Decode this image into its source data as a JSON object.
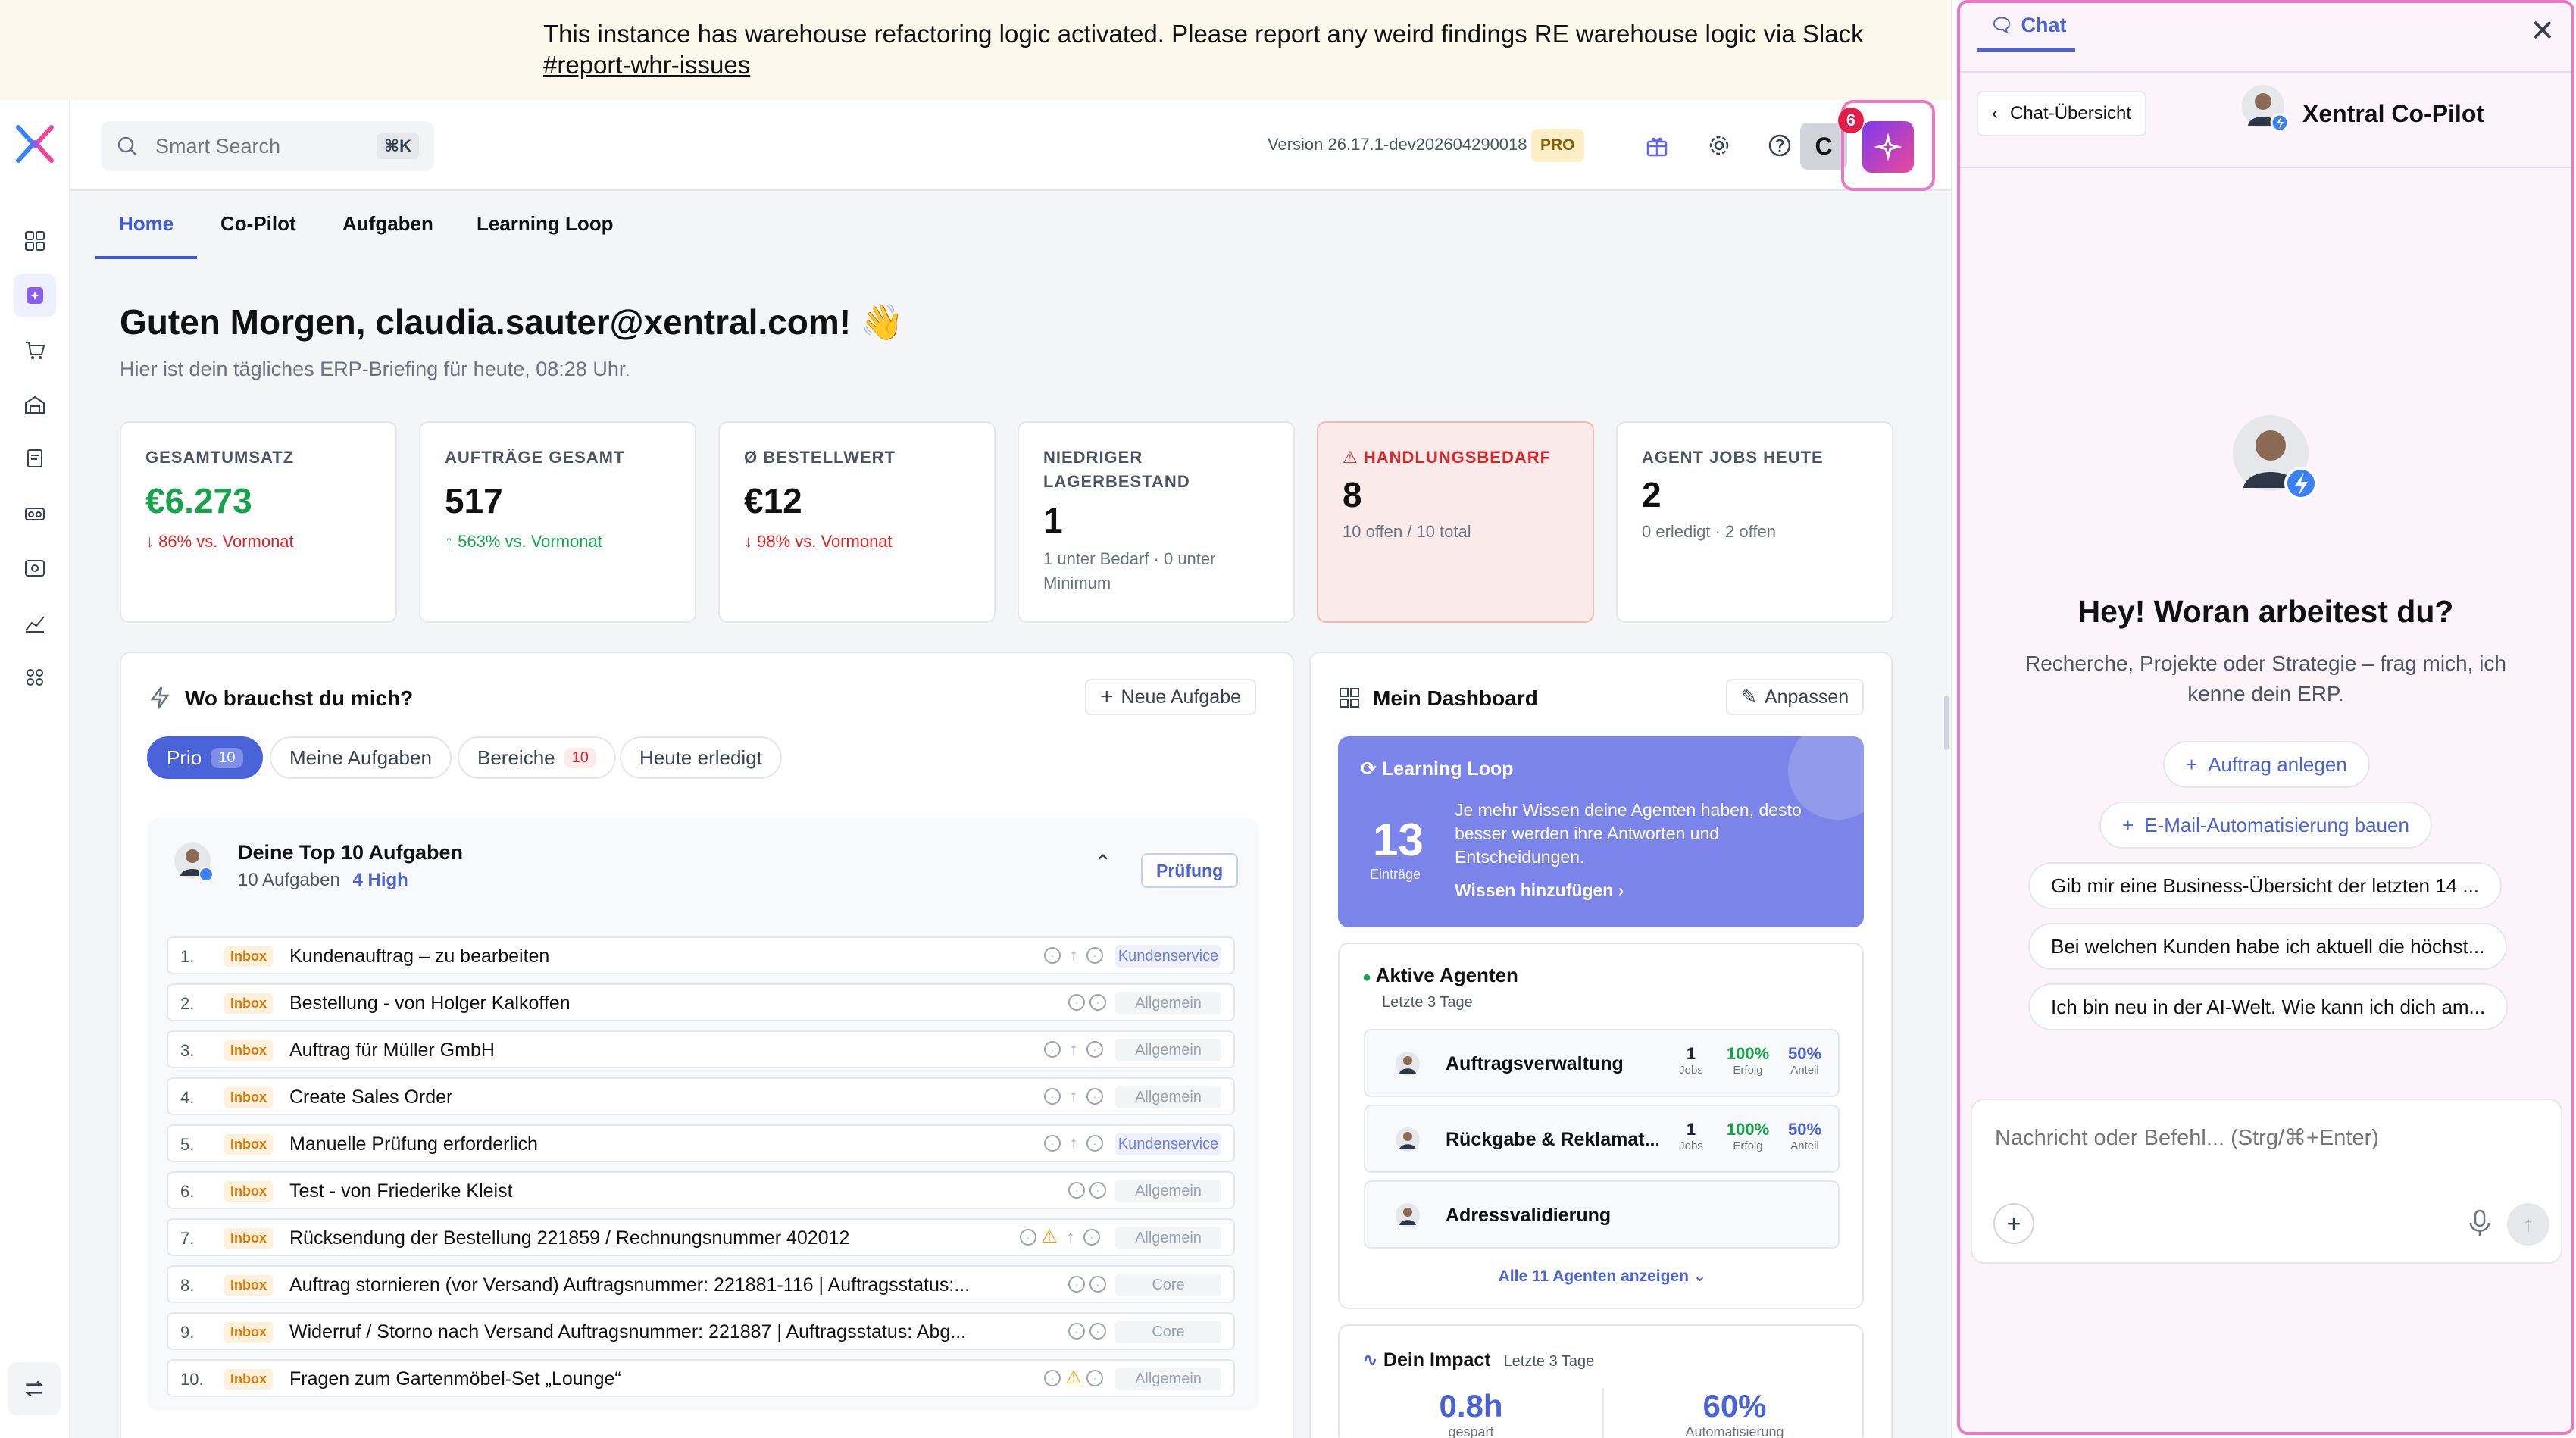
{
  "banner": {
    "text": "This instance has warehouse refactoring logic activated. Please report any weird findings RE warehouse logic via Slack ",
    "link": "#report-whr-issues"
  },
  "topbar": {
    "search_placeholder": "Smart Search",
    "search_shortcut": "⌘K",
    "version": "Version 26.17.1-dev202604290018",
    "plan_badge": "PRO",
    "user_initial": "C",
    "notification_count": "6"
  },
  "tabs": [
    "Home",
    "Co-Pilot",
    "Aufgaben",
    "Learning Loop"
  ],
  "greeting": {
    "title": "Guten Morgen, claudia.sauter@xentral.com! 👋",
    "subtitle": "Hier ist dein tägliches ERP-Briefing für heute, 08:28 Uhr."
  },
  "kpis": [
    {
      "label": "GESAMTUMSATZ",
      "value": "€6.273",
      "delta": "↓ 86% vs. Vormonat"
    },
    {
      "label": "AUFTRÄGE GESAMT",
      "value": "517",
      "delta": "↑ 563% vs. Vormonat"
    },
    {
      "label": "Ø BESTELLWERT",
      "value": "€12",
      "delta": "↓ 98% vs. Vormonat"
    },
    {
      "label": "NIEDRIGER LAGERBESTAND",
      "value": "1",
      "delta": "1 unter Bedarf · 0 unter Minimum"
    },
    {
      "label": "HANDLUNGSBEDARF",
      "value": "8",
      "delta": "10 offen / 10 total"
    },
    {
      "label": "AGENT JOBS HEUTE",
      "value": "2",
      "delta": "0 erledigt · 2 offen"
    }
  ],
  "tasks_panel": {
    "title": "Wo brauchst du mich?",
    "new_task": "Neue Aufgabe",
    "chips": [
      {
        "label": "Prio",
        "count": "10"
      },
      {
        "label": "Meine Aufgaben",
        "count": ""
      },
      {
        "label": "Bereiche",
        "count": "10"
      },
      {
        "label": "Heute erledigt",
        "count": ""
      }
    ],
    "top10_title": "Deine Top 10 Aufgaben",
    "top10_count": "10 Aufgaben",
    "top10_high": "4 High",
    "review_button": "Prüfung",
    "rows": [
      {
        "num": "1.",
        "tag": "Inbox",
        "text": "Kundenauftrag – zu bearbeiten",
        "category": "Kundenservice"
      },
      {
        "num": "2.",
        "tag": "Inbox",
        "text": "Bestellung - von Holger Kalkoffen",
        "category": "Allgemein"
      },
      {
        "num": "3.",
        "tag": "Inbox",
        "text": "Auftrag für Müller GmbH",
        "category": "Allgemein"
      },
      {
        "num": "4.",
        "tag": "Inbox",
        "text": "Create Sales Order",
        "category": "Allgemein"
      },
      {
        "num": "5.",
        "tag": "Inbox",
        "text": "Manuelle Prüfung erforderlich",
        "category": "Kundenservice"
      },
      {
        "num": "6.",
        "tag": "Inbox",
        "text": "Test - von Friederike Kleist",
        "category": "Allgemein"
      },
      {
        "num": "7.",
        "tag": "Inbox",
        "text": "Rücksendung der Bestellung 221859 / Rechnungsnummer 402012",
        "category": "Allgemein"
      },
      {
        "num": "8.",
        "tag": "Inbox",
        "text": "Auftrag stornieren (vor Versand) Auftragsnummer: 221881-116 | Auftragsstatus:...",
        "category": "Core"
      },
      {
        "num": "9.",
        "tag": "Inbox",
        "text": "Widerruf / Storno nach Versand Auftragsnummer: 221887 | Auftragsstatus: Abg...",
        "category": "Core"
      },
      {
        "num": "10.",
        "tag": "Inbox",
        "text": "Fragen zum Gartenmöbel-Set „Lounge“",
        "category": "Allgemein"
      }
    ]
  },
  "dashboard": {
    "title": "Mein Dashboard",
    "customize": "Anpassen",
    "learning_loop": {
      "title": "Learning Loop",
      "count": "13",
      "count_label": "Einträge",
      "text": "Je mehr Wissen deine Agenten haben, desto besser werden ihre Antworten und Entscheidungen.",
      "cta": "Wissen hinzufügen ›"
    },
    "agents": {
      "title": "Aktive Agenten",
      "subtitle": "Letzte 3 Tage",
      "list": [
        {
          "name": "Auftragsverwaltung",
          "jobs": "1",
          "jobs_label": "Jobs",
          "success": "100%",
          "success_label": "Erfolg",
          "share": "50%",
          "share_label": "Anteil"
        },
        {
          "name": "Rückgabe & Reklamat...",
          "jobs": "1",
          "jobs_label": "Jobs",
          "success": "100%",
          "success_label": "Erfolg",
          "share": "50%",
          "share_label": "Anteil"
        },
        {
          "name": "Adressvalidierung",
          "jobs": "",
          "jobs_label": "",
          "success": "",
          "success_label": "",
          "share": "",
          "share_label": ""
        }
      ],
      "show_all": "Alle 11 Agenten anzeigen"
    },
    "impact": {
      "title": "Dein Impact",
      "subtitle": "Letzte 3 Tage",
      "metric1_value": "0.8h",
      "metric1_label": "gespart",
      "metric2_value": "60%",
      "metric2_label": "Automatisierung"
    }
  },
  "chat": {
    "tab": "Chat",
    "back": "Chat-Übersicht",
    "title": "Xentral Co-Pilot",
    "heading": "Hey! Woran arbeitest du?",
    "subheading": "Recherche, Projekte oder Strategie – frag mich, ich kenne dein ERP.",
    "suggestions": [
      "Auftrag anlegen",
      "E-Mail-Automatisierung bauen",
      "Gib mir eine Business-Übersicht der letzten 14 ...",
      "Bei welchen Kunden habe ich aktuell die höchst...",
      "Ich bin neu in der AI-Welt. Wie kann ich dich am..."
    ],
    "input_placeholder": "Nachricht oder Befehl... (Strg/⌘+Enter)"
  },
  "colors": {
    "accent": "#4a63d8",
    "positive": "#16a34a",
    "negative": "#dc2626",
    "highlight_border": "#e879c5"
  }
}
